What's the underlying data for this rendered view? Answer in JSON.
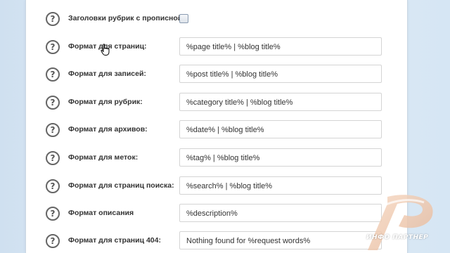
{
  "settings": {
    "rows": [
      {
        "label": "Заголовки рубрик с прописной:",
        "type": "checkbox",
        "checked": false
      },
      {
        "label": "Формат для страниц:",
        "type": "text",
        "value": "%page  title% | %blog  title%"
      },
      {
        "label": "Формат для записей:",
        "type": "text",
        "value": "%post  title% | %blog  title%"
      },
      {
        "label": "Формат для рубрик:",
        "type": "text",
        "value": "%category  title% | %blog  title%"
      },
      {
        "label": "Формат для архивов:",
        "type": "text",
        "value": "%date% | %blog  title%"
      },
      {
        "label": "Формат для меток:",
        "type": "text",
        "value": "%tag% | %blog  title%"
      },
      {
        "label": "Формат для страниц поиска:",
        "type": "text",
        "value": "%search% | %blog  title%"
      },
      {
        "label": "Формат описания",
        "type": "text",
        "value": "%description%"
      },
      {
        "label": "Формат для страниц 404:",
        "type": "text",
        "value": "Nothing found for %request  words%"
      }
    ],
    "help_icon": "?"
  },
  "watermark": {
    "text": "ИНФО ПАРТНЕР",
    "icon": "infopartner-logo"
  },
  "cursor": {
    "icon": "hand-pointer-icon"
  }
}
